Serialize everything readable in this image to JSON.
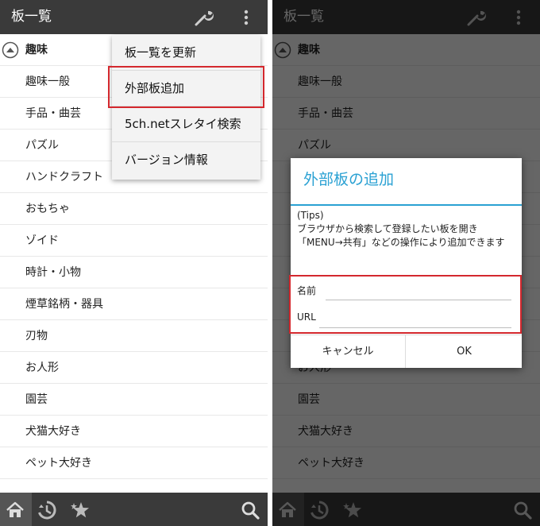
{
  "app": {
    "title": "板一覧"
  },
  "list": {
    "header": "趣味",
    "items": [
      "趣味一般",
      "手品・曲芸",
      "パズル",
      "ハンドクラフト",
      "おもちゃ",
      "ゾイド",
      "時計・小物",
      "煙草銘柄・器具",
      "刃物",
      "お人形",
      "園芸",
      "犬猫大好き",
      "ペット大好き"
    ]
  },
  "menu": {
    "items": [
      "板一覧を更新",
      "外部板追加",
      "5ch.netスレタイ検索",
      "バージョン情報"
    ]
  },
  "dialog": {
    "title": "外部板の追加",
    "tips_heading": "(Tips)",
    "tips_body": "ブラウザから検索して登録したい板を開き「MENU→共有」などの操作により追加できます",
    "name_label": "名前",
    "url_label": "URL",
    "name_value": "",
    "url_value": "",
    "cancel_label": "キャンセル",
    "ok_label": "OK"
  },
  "icons": {
    "wrench": "wrench-icon",
    "overflow": "overflow-menu-icon",
    "home": "home-icon",
    "history": "history-icon",
    "favorites": "favorites-icon",
    "search": "search-icon",
    "collapse": "collapse-up-icon"
  },
  "colors": {
    "appbar": "#3a3a3a",
    "accent": "#2aa1d3",
    "highlight": "#d4282e"
  }
}
